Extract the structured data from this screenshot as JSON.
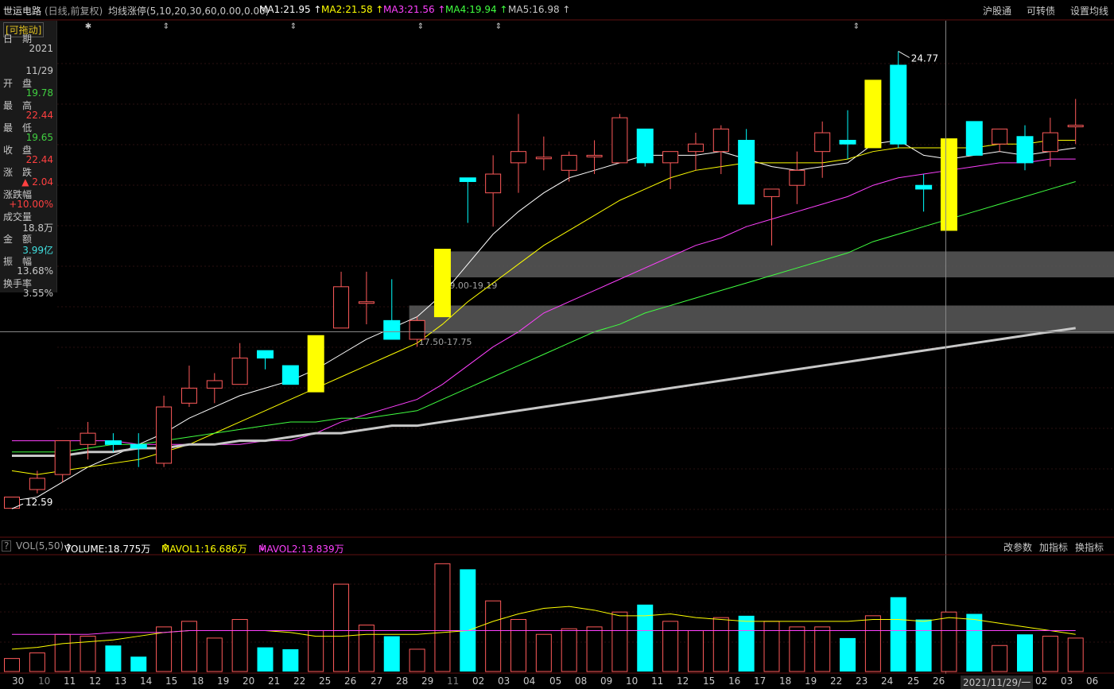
{
  "header": {
    "stock_name": "世运电路",
    "mode": "(日线,前复权)",
    "indicator": "均线涨停(5,10,20,30,60,0.00,0.00)",
    "ma1": "MA1:21.95",
    "ma2": "MA2:21.58",
    "ma3": "MA3:21.56",
    "ma4": "MA4:19.94",
    "ma5": "MA5:16.98",
    "up_arrow": "↑",
    "links": [
      "沪股通",
      "可转债",
      "设置均线"
    ]
  },
  "info_panel": {
    "drag_label": "[可拖动]",
    "rows": [
      {
        "label": "日　期",
        "value": "2021",
        "color": "#c8c8c8"
      },
      {
        "label": "",
        "value": "11/29",
        "color": "#c8c8c8"
      },
      {
        "label": "开　盘",
        "value": "19.78",
        "color": "#40d040"
      },
      {
        "label": "最　高",
        "value": "22.44",
        "color": "#ff4040"
      },
      {
        "label": "最　低",
        "value": "19.65",
        "color": "#40d040"
      },
      {
        "label": "收　盘",
        "value": "22.44",
        "color": "#ff4040"
      },
      {
        "label": "涨　跌",
        "value": "▲ 2.04",
        "color": "#ff4040"
      },
      {
        "label": "涨跌幅",
        "value": "+10.00%",
        "color": "#ff4040"
      },
      {
        "label": "成交量",
        "value": "18.8万",
        "color": "#c8c8c8"
      },
      {
        "label": "金　额",
        "value": "3.99亿",
        "color": "#40e0e0"
      },
      {
        "label": "振　幅",
        "value": "13.68%",
        "color": "#c8c8c8"
      },
      {
        "label": "换手率",
        "value": "3.55%",
        "color": "#c8c8c8"
      }
    ]
  },
  "annotations": {
    "high": "24.77",
    "low": "12.59",
    "zone1": "19.00-19.19",
    "zone2": "17.50-17.75",
    "markers": [
      "✱",
      "⇕",
      "⇕",
      "⇕",
      "⇕",
      "⇕"
    ]
  },
  "volume": {
    "help": "?",
    "title": "VOL(5,50)",
    "volume": "VOLUME:18.775万",
    "mavol1": "MAVOL1:16.686万",
    "mavol2": "MAVOL2:13.839万",
    "up_arrow": "↑",
    "down_arrow": "↓",
    "links": [
      "改参数",
      "加指标",
      "换指标"
    ]
  },
  "dates": [
    "30",
    "10",
    "11",
    "12",
    "13",
    "14",
    "15",
    "18",
    "19",
    "20",
    "21",
    "22",
    "25",
    "26",
    "27",
    "28",
    "29",
    "11",
    "02",
    "03",
    "04",
    "05",
    "08",
    "09",
    "10",
    "11",
    "12",
    "15",
    "16",
    "17",
    "18",
    "19",
    "22",
    "23",
    "24",
    "25",
    "26",
    "2021/11/29/一",
    "02",
    "03",
    "06"
  ],
  "colors": {
    "up": "#ff5a5a",
    "down": "#00ffff",
    "limit": "#ffff00",
    "bg": "#000000"
  },
  "chart_data": {
    "type": "candlestick",
    "candles": [
      {
        "o": 12.6,
        "c": 12.9,
        "h": 12.9,
        "l": 12.59
      },
      {
        "o": 13.1,
        "c": 13.4,
        "h": 13.6,
        "l": 13.0
      },
      {
        "o": 13.5,
        "c": 14.4,
        "h": 14.4,
        "l": 13.3
      },
      {
        "o": 14.3,
        "c": 14.6,
        "h": 14.9,
        "l": 13.9
      },
      {
        "o": 14.4,
        "c": 14.3,
        "h": 14.6,
        "l": 14.1
      },
      {
        "o": 14.3,
        "c": 14.2,
        "h": 14.6,
        "l": 13.7
      },
      {
        "o": 13.8,
        "c": 15.3,
        "h": 15.6,
        "l": 13.7
      },
      {
        "o": 15.4,
        "c": 15.8,
        "h": 16.4,
        "l": 15.3
      },
      {
        "o": 15.8,
        "c": 16.0,
        "h": 16.2,
        "l": 15.4
      },
      {
        "o": 15.9,
        "c": 16.6,
        "h": 17.0,
        "l": 15.9
      },
      {
        "o": 16.8,
        "c": 16.6,
        "h": 16.8,
        "l": 16.3
      },
      {
        "o": 16.4,
        "c": 15.9,
        "h": 16.4,
        "l": 15.9
      },
      {
        "o": 15.7,
        "c": 17.2,
        "h": 17.2,
        "l": 15.7
      },
      {
        "o": 17.4,
        "c": 18.5,
        "h": 18.9,
        "l": 17.4
      },
      {
        "o": 18.1,
        "c": 18.1,
        "h": 18.9,
        "l": 17.5
      },
      {
        "o": 17.6,
        "c": 17.1,
        "h": 18.7,
        "l": 17.1
      },
      {
        "o": 17.1,
        "c": 17.6,
        "h": 17.7,
        "l": 16.9
      },
      {
        "o": 17.7,
        "c": 19.5,
        "h": 19.5,
        "l": 17.7
      },
      {
        "o": 21.4,
        "c": 21.3,
        "h": 21.3,
        "l": 20.2
      },
      {
        "o": 21.0,
        "c": 21.5,
        "h": 22.0,
        "l": 20.1
      },
      {
        "o": 21.8,
        "c": 22.1,
        "h": 23.1,
        "l": 21.0
      },
      {
        "o": 21.95,
        "c": 21.95,
        "h": 22.5,
        "l": 21.6
      },
      {
        "o": 21.6,
        "c": 22.0,
        "h": 22.1,
        "l": 21.3
      },
      {
        "o": 22.0,
        "c": 22.0,
        "h": 22.4,
        "l": 21.5
      },
      {
        "o": 21.8,
        "c": 23.0,
        "h": 23.1,
        "l": 21.8
      },
      {
        "o": 22.7,
        "c": 21.8,
        "h": 22.7,
        "l": 21.7
      },
      {
        "o": 21.8,
        "c": 22.1,
        "h": 22.1,
        "l": 21.1
      },
      {
        "o": 22.1,
        "c": 22.3,
        "h": 22.6,
        "l": 21.6
      },
      {
        "o": 22.1,
        "c": 22.7,
        "h": 22.8,
        "l": 21.5
      },
      {
        "o": 22.4,
        "c": 20.7,
        "h": 22.7,
        "l": 20.7
      },
      {
        "o": 20.9,
        "c": 21.1,
        "h": 21.1,
        "l": 19.6
      },
      {
        "o": 21.2,
        "c": 21.6,
        "h": 22.1,
        "l": 20.7
      },
      {
        "o": 22.1,
        "c": 22.6,
        "h": 22.9,
        "l": 21.4
      },
      {
        "o": 22.4,
        "c": 22.3,
        "h": 23.2,
        "l": 21.9
      },
      {
        "o": 22.2,
        "c": 24.0,
        "h": 24.0,
        "l": 22.2
      },
      {
        "o": 24.4,
        "c": 22.3,
        "h": 24.77,
        "l": 22.2
      },
      {
        "o": 21.2,
        "c": 21.1,
        "h": 21.5,
        "l": 20.5
      },
      {
        "o": 22.44,
        "c": 20.0,
        "h": 22.44,
        "l": 20.0
      },
      {
        "o": 22.9,
        "c": 22.0,
        "h": 22.9,
        "l": 22.0
      },
      {
        "o": 22.3,
        "c": 22.7,
        "h": 22.7,
        "l": 22.1
      },
      {
        "o": 22.5,
        "c": 21.8,
        "h": 22.8,
        "l": 21.6
      },
      {
        "o": 22.1,
        "c": 22.6,
        "h": 23.0,
        "l": 21.7
      },
      {
        "o": 22.8,
        "c": 22.8,
        "h": 23.5,
        "l": 22.3
      }
    ],
    "limit_up_indices": [
      12,
      17,
      34,
      37
    ],
    "ma_series": [
      {
        "name": "MA1",
        "color": "#ffffff",
        "values": [
          12.8,
          12.9,
          13.3,
          13.7,
          14.0,
          14.3,
          14.6,
          15.0,
          15.3,
          15.6,
          15.8,
          16.0,
          16.3,
          16.7,
          17.1,
          17.4,
          17.7,
          18.3,
          19.1,
          19.9,
          20.5,
          21.0,
          21.4,
          21.6,
          21.8,
          22.0,
          22.0,
          22.0,
          22.1,
          21.9,
          21.7,
          21.6,
          21.7,
          21.8,
          22.3,
          22.4,
          22.0,
          21.9,
          22.0,
          22.1,
          22.0,
          22.1,
          22.2
        ]
      },
      {
        "name": "MA2",
        "color": "#ffff00",
        "values": [
          13.6,
          13.5,
          13.6,
          13.7,
          13.8,
          13.9,
          14.1,
          14.3,
          14.6,
          14.9,
          15.2,
          15.5,
          15.8,
          16.1,
          16.4,
          16.7,
          17.0,
          17.5,
          18.1,
          18.6,
          19.1,
          19.6,
          20.0,
          20.4,
          20.8,
          21.1,
          21.4,
          21.6,
          21.7,
          21.8,
          21.8,
          21.8,
          21.8,
          21.9,
          22.1,
          22.2,
          22.2,
          22.2,
          22.2,
          22.3,
          22.3,
          22.4,
          22.4
        ]
      },
      {
        "name": "MA3",
        "color": "#ff40ff",
        "values": [
          14.4,
          14.4,
          14.4,
          14.4,
          14.4,
          14.3,
          14.3,
          14.3,
          14.3,
          14.3,
          14.4,
          14.4,
          14.6,
          14.9,
          15.1,
          15.3,
          15.5,
          15.9,
          16.4,
          16.9,
          17.3,
          17.8,
          18.1,
          18.4,
          18.7,
          19.0,
          19.3,
          19.6,
          19.8,
          20.1,
          20.3,
          20.5,
          20.7,
          20.9,
          21.2,
          21.4,
          21.5,
          21.6,
          21.7,
          21.8,
          21.8,
          21.9,
          21.9
        ]
      },
      {
        "name": "MA4",
        "color": "#40ff40",
        "values": [
          14.1,
          14.1,
          14.1,
          14.2,
          14.3,
          14.3,
          14.4,
          14.5,
          14.6,
          14.7,
          14.8,
          14.9,
          14.9,
          15.0,
          15.0,
          15.1,
          15.2,
          15.5,
          15.8,
          16.1,
          16.4,
          16.7,
          17.0,
          17.3,
          17.5,
          17.8,
          18.0,
          18.2,
          18.4,
          18.6,
          18.8,
          19.0,
          19.2,
          19.4,
          19.7,
          19.9,
          20.1,
          20.3,
          20.5,
          20.7,
          20.9,
          21.1,
          21.3
        ]
      },
      {
        "name": "MA5",
        "color": "#c8c8c8",
        "values": [
          14.0,
          14.0,
          14.0,
          14.1,
          14.1,
          14.2,
          14.2,
          14.3,
          14.3,
          14.4,
          14.4,
          14.5,
          14.6,
          14.6,
          14.7,
          14.8,
          14.8,
          14.9,
          15.0,
          15.1,
          15.2,
          15.3,
          15.4,
          15.5,
          15.6,
          15.7,
          15.8,
          15.9,
          16.0,
          16.1,
          16.2,
          16.3,
          16.4,
          16.5,
          16.6,
          16.7,
          16.8,
          16.9,
          17.0,
          17.1,
          17.2,
          17.3,
          17.4
        ]
      }
    ],
    "zones": [
      {
        "label": "19.00-19.19",
        "low": 19.0,
        "high": 19.19,
        "start_index": 17
      },
      {
        "label": "17.50-17.75",
        "low": 17.5,
        "high": 17.75,
        "start_index": 16
      }
    ],
    "crosshair": {
      "index": 37,
      "price": 17.3
    },
    "volumes": [
      7,
      10,
      20,
      19,
      14,
      8,
      24,
      27,
      18,
      28,
      13,
      12,
      22,
      47,
      25,
      19,
      12,
      58,
      55,
      38,
      28,
      20,
      23,
      24,
      32,
      36,
      27,
      22,
      29,
      30,
      27,
      24,
      24,
      18,
      30,
      40,
      28,
      32,
      31,
      14,
      20,
      19,
      18
    ],
    "mavol1": [
      12,
      13,
      15,
      16,
      17,
      19,
      21,
      22,
      22,
      22,
      22,
      21,
      19,
      19,
      20,
      20,
      20,
      21,
      22,
      27,
      31,
      34,
      35,
      33,
      30,
      30,
      31,
      29,
      28,
      27,
      27,
      27,
      27,
      27,
      28,
      28,
      27,
      29,
      28,
      26,
      24,
      22,
      20
    ],
    "mavol2": [
      20,
      20,
      20,
      20,
      21,
      21,
      21,
      22,
      22,
      22,
      22,
      22,
      22,
      22,
      22,
      22,
      22,
      22,
      22,
      22,
      22,
      22,
      22,
      22,
      22,
      22,
      22,
      22,
      22,
      22,
      22,
      22,
      22,
      22,
      22,
      22,
      22,
      22,
      22,
      22,
      22,
      22,
      22
    ],
    "ylim_price": [
      12.0,
      25.5
    ],
    "ylim_volume": [
      0,
      62
    ]
  }
}
